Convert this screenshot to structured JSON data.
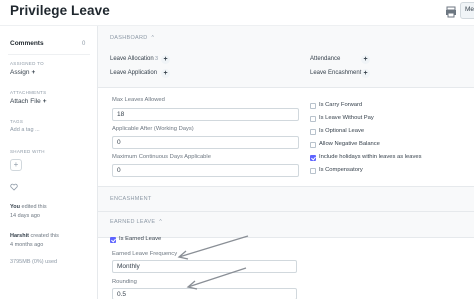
{
  "header": {
    "title": "Privilege Leave",
    "menu_label": "Me"
  },
  "sidebar": {
    "comments_label": "Comments",
    "comments_count": "0",
    "assigned_to_label": "ASSIGNED TO",
    "assign_action": "Assign",
    "attachments_label": "ATTACHMENTS",
    "attach_action": "Attach File",
    "tags_label": "TAGS",
    "add_tag": "Add a tag ...",
    "shared_with_label": "SHARED WITH",
    "share_add": "+",
    "activity": [
      {
        "user": "You",
        "action": "edited this",
        "when": "14 days ago"
      },
      {
        "user": "Harshit",
        "action": "created this",
        "when": "4 months ago"
      }
    ],
    "storage": "3795MB (0%) used"
  },
  "dashboard": {
    "section_label": "DASHBOARD",
    "links": [
      {
        "label": "Leave Allocation",
        "count": "3"
      },
      {
        "label": "Leave Application",
        "count": ""
      },
      {
        "label": "Attendance",
        "count": ""
      },
      {
        "label": "Leave Encashment",
        "count": ""
      }
    ]
  },
  "form": {
    "max_leaves_label": "Max Leaves Allowed",
    "max_leaves_value": "18",
    "applicable_after_label": "Applicable After (Working Days)",
    "applicable_after_value": "0",
    "max_continuous_label": "Maximum Continuous Days Applicable",
    "max_continuous_value": "0",
    "checkboxes": [
      {
        "label": "Is Carry Forward",
        "checked": false
      },
      {
        "label": "Is Leave Without Pay",
        "checked": false
      },
      {
        "label": "Is Optional Leave",
        "checked": false
      },
      {
        "label": "Allow Negative Balance",
        "checked": false
      },
      {
        "label": "Include holidays within leaves as leaves",
        "checked": true
      },
      {
        "label": "Is Compensatory",
        "checked": false
      }
    ]
  },
  "encashment": {
    "section_label": "ENCASHMENT"
  },
  "earned_leave": {
    "section_label": "EARNED LEAVE",
    "is_earned_label": "Is Earned Leave",
    "is_earned_checked": true,
    "frequency_label": "Earned Leave Frequency",
    "frequency_value": "Monthly",
    "rounding_label": "Rounding",
    "rounding_value": "0.5"
  },
  "colors": {
    "accent": "#5e64ff",
    "annotation_arrow": "#8a8f96"
  }
}
